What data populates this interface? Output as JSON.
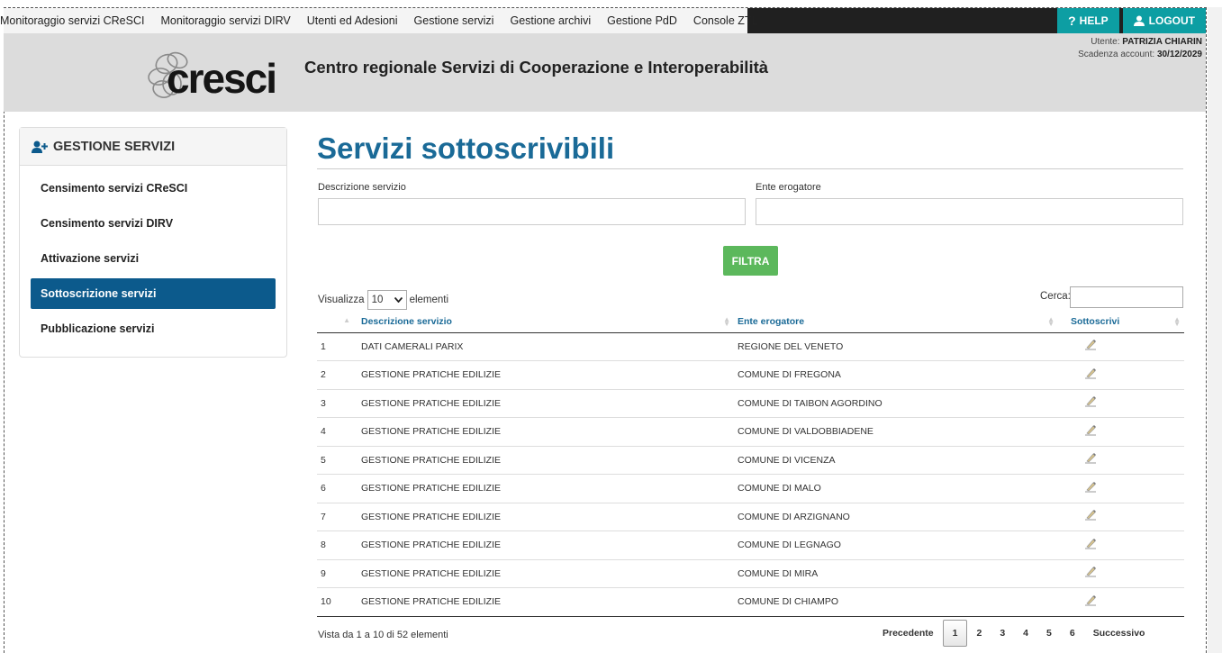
{
  "topnav": {
    "items": [
      "Monitoraggio servizi CReSCI",
      "Monitoraggio servizi DIRV",
      "Utenti ed Adesioni",
      "Gestione servizi",
      "Gestione archivi",
      "Gestione PdD",
      "Console ZTL"
    ],
    "help_label": "HELP",
    "logout_label": "LOGOUT",
    "accent_color": "#0d9ea3"
  },
  "header": {
    "logo_text": "cresci",
    "title": "Centro regionale Servizi di Cooperazione e Interoperabilità",
    "user_label": "Utente:",
    "user_name": "PATRIZIA CHIARIN",
    "expiry_label": "Scadenza account:",
    "expiry_date": "30/12/2029"
  },
  "sidebar": {
    "title": "GESTIONE SERVIZI",
    "items": [
      "Censimento servizi CReSCI",
      "Censimento servizi DIRV",
      "Attivazione servizi",
      "Sottoscrizione servizi",
      "Pubblicazione servizi"
    ],
    "active_color": "#0c5a8c"
  },
  "main": {
    "title": "Servizi sottoscrivibili",
    "filter": {
      "descrizione_label": "Descrizione servizio",
      "descrizione_value": "",
      "ente_label": "Ente erogatore",
      "ente_value": "",
      "button_label": "FILTRA"
    },
    "table_controls": {
      "show_label": "Visualizza",
      "show_value": "10",
      "entries_label": "elementi",
      "search_label": "Cerca:",
      "search_value": ""
    },
    "table": {
      "columns": [
        "",
        "Descrizione servizio",
        "Ente erogatore",
        "Sottoscrivi"
      ],
      "rows": [
        {
          "n": "1",
          "descrizione": "DATI CAMERALI PARIX",
          "ente": "REGIONE DEL VENETO"
        },
        {
          "n": "2",
          "descrizione": "GESTIONE PRATICHE EDILIZIE",
          "ente": "COMUNE DI FREGONA"
        },
        {
          "n": "3",
          "descrizione": "GESTIONE PRATICHE EDILIZIE",
          "ente": "COMUNE DI TAIBON AGORDINO"
        },
        {
          "n": "4",
          "descrizione": "GESTIONE PRATICHE EDILIZIE",
          "ente": "COMUNE DI VALDOBBIADENE"
        },
        {
          "n": "5",
          "descrizione": "GESTIONE PRATICHE EDILIZIE",
          "ente": "COMUNE DI VICENZA"
        },
        {
          "n": "6",
          "descrizione": "GESTIONE PRATICHE EDILIZIE",
          "ente": "COMUNE DI MALO"
        },
        {
          "n": "7",
          "descrizione": "GESTIONE PRATICHE EDILIZIE",
          "ente": "COMUNE DI ARZIGNANO"
        },
        {
          "n": "8",
          "descrizione": "GESTIONE PRATICHE EDILIZIE",
          "ente": "COMUNE DI LEGNAGO"
        },
        {
          "n": "9",
          "descrizione": "GESTIONE PRATICHE EDILIZIE",
          "ente": "COMUNE DI MIRA"
        },
        {
          "n": "10",
          "descrizione": "GESTIONE PRATICHE EDILIZIE",
          "ente": "COMUNE DI CHIAMPO"
        }
      ],
      "subscribe_icon": "pen-sign-icon"
    },
    "info": "Vista da 1 a 10 di 52 elementi",
    "pager": {
      "prev_label": "Precedente",
      "pages": [
        "1",
        "2",
        "3",
        "4",
        "5",
        "6"
      ],
      "current": "1",
      "next_label": "Successivo"
    }
  }
}
